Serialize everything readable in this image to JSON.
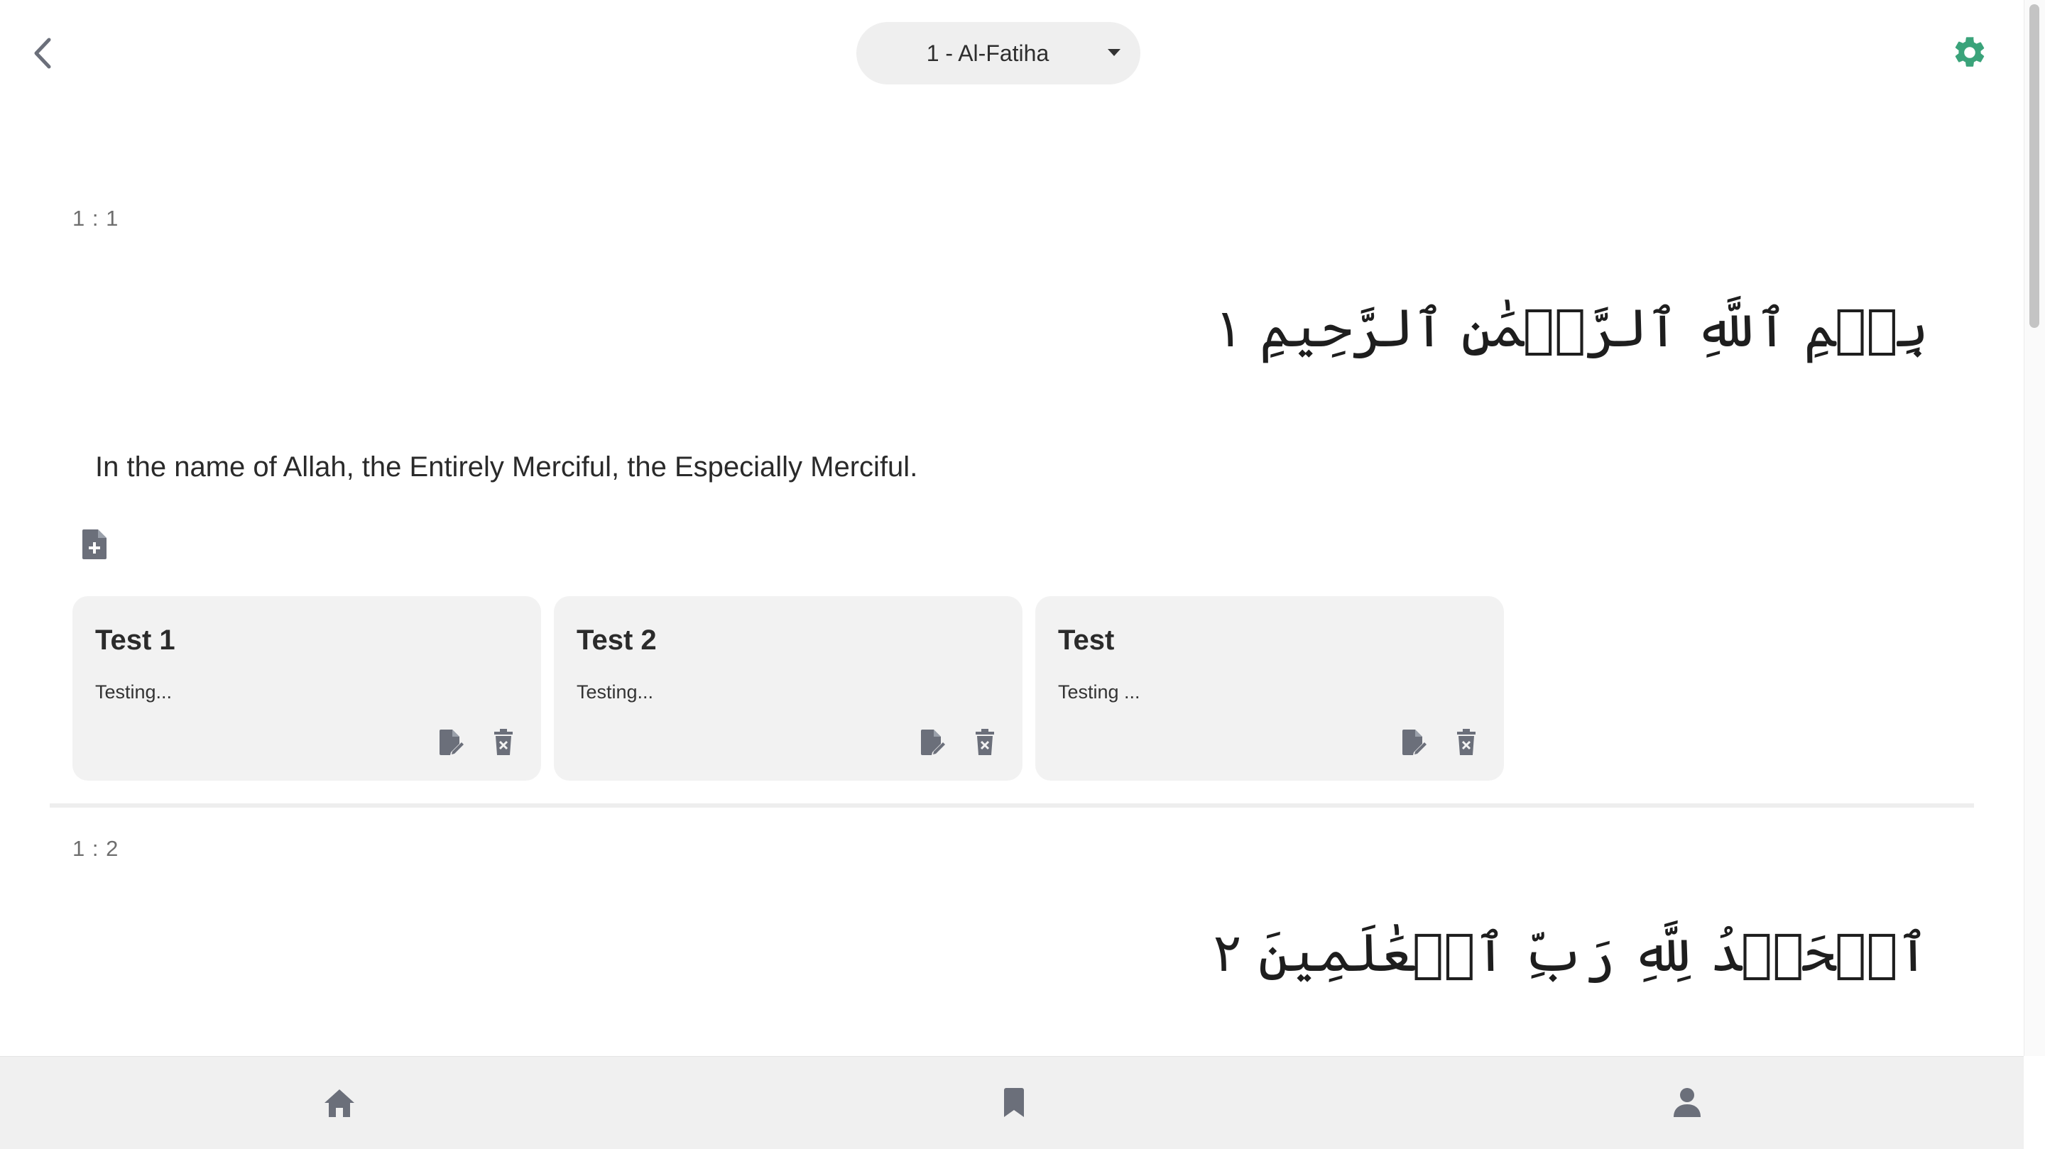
{
  "header": {
    "back_icon": "chevron-left-icon",
    "chapter_selected": "1 - Al-Fatiha",
    "settings_icon": "gear-icon",
    "accent_color": "#3aa37a"
  },
  "verses": [
    {
      "ref": "1 : 1",
      "arabic": "بِسۡمِ ٱللَّهِ ٱلرَّحۡمَٰنِ ٱلرَّحِيمِ ١",
      "translation": "In the name of Allah, the Entirely Merciful, the Especially Merciful.",
      "add_note_icon": "add-note-icon",
      "notes": [
        {
          "title": "Test 1",
          "body": "Testing..."
        },
        {
          "title": "Test 2",
          "body": "Testing..."
        },
        {
          "title": "Test",
          "body": "Testing ..."
        }
      ]
    },
    {
      "ref": "1 : 2",
      "arabic": "ٱلۡحَمۡدُ لِلَّهِ رَبِّ ٱلۡعَٰلَمِينَ ٢"
    }
  ],
  "bottom_nav": {
    "items": [
      {
        "icon": "home-icon"
      },
      {
        "icon": "bookmark-icon"
      },
      {
        "icon": "profile-icon"
      }
    ]
  },
  "colors": {
    "icon_gray": "#6b6f7a",
    "card_bg": "#f2f2f2",
    "nav_bg": "#f0f0f0"
  }
}
